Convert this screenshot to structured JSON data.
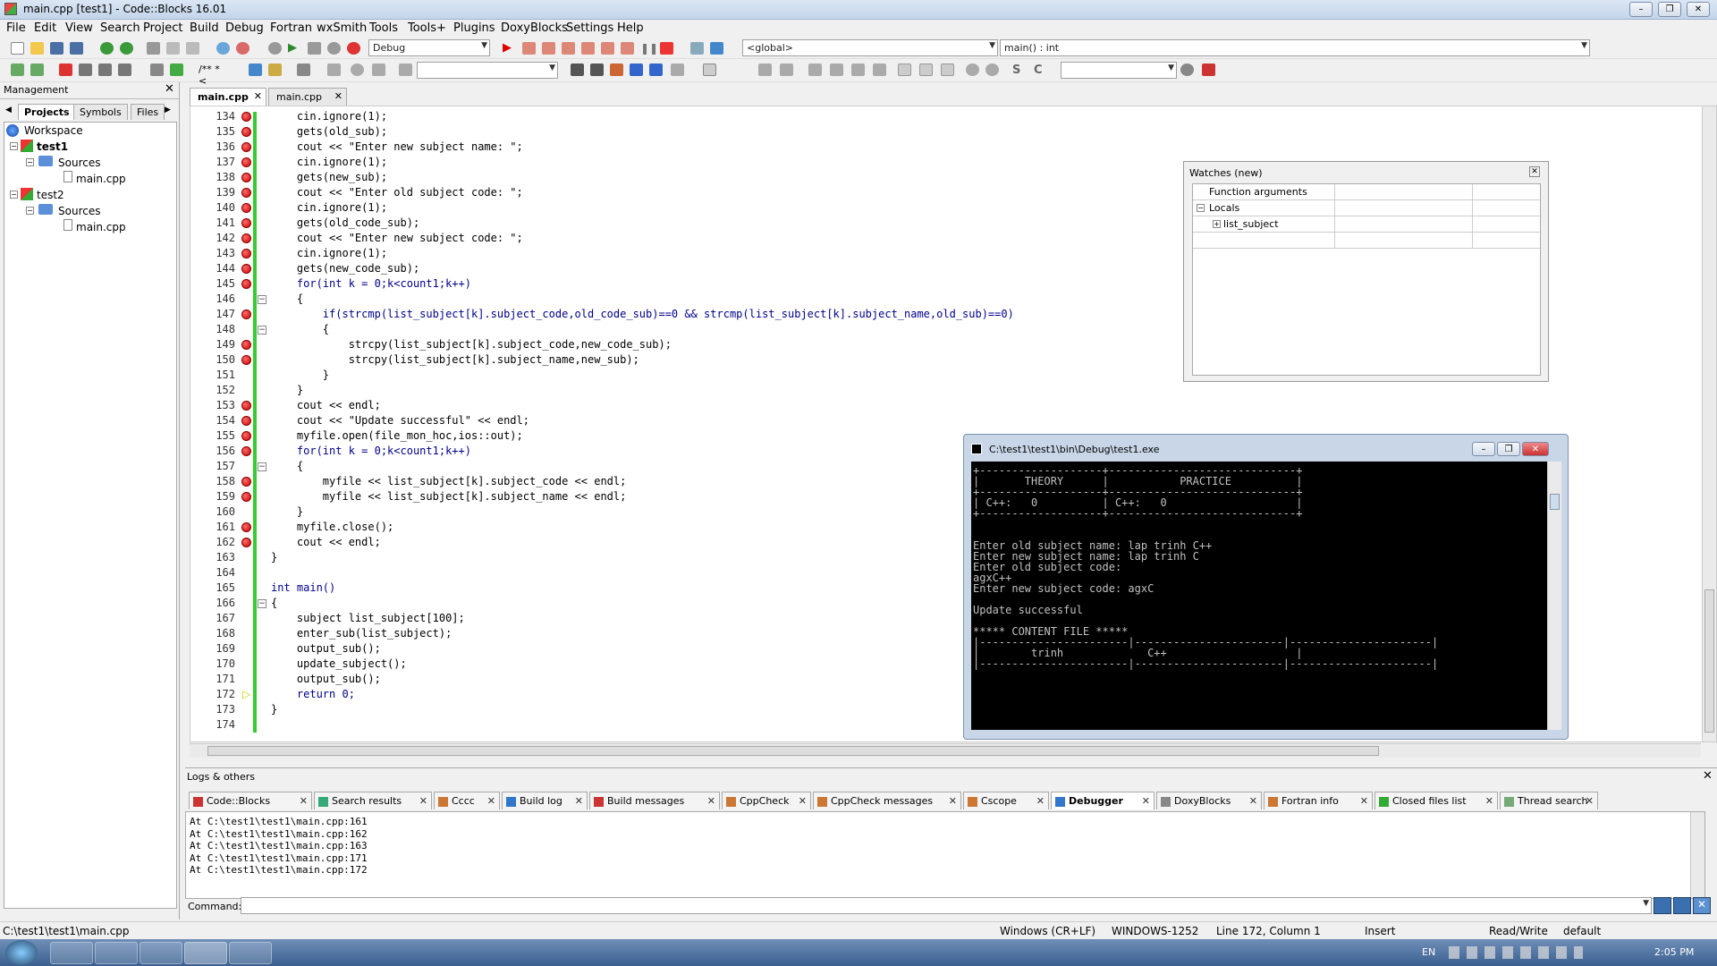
{
  "window": {
    "title": "main.cpp [test1] - Code::Blocks 16.01"
  },
  "menu": [
    "File",
    "Edit",
    "View",
    "Search",
    "Project",
    "Build",
    "Debug",
    "Fortran",
    "wxSmith",
    "Tools",
    "Tools+",
    "Plugins",
    "DoxyBlocks",
    "Settings",
    "Help"
  ],
  "toolbar": {
    "build_target": "Debug",
    "scope": "<global>",
    "function": "main() : int"
  },
  "management": {
    "title": "Management",
    "tabs": [
      "Projects",
      "Symbols",
      "Files"
    ],
    "tree": [
      "Workspace",
      "test1",
      "Sources",
      "main.cpp",
      "test2",
      "Sources",
      "main.cpp"
    ]
  },
  "editor": {
    "tabs": [
      "main.cpp",
      "main.cpp"
    ],
    "lines": [
      {
        "n": "134",
        "t": "    cin.ignore(1);"
      },
      {
        "n": "135",
        "t": "    gets(old_sub);"
      },
      {
        "n": "136",
        "t": "    cout << \"Enter new subject name: \";"
      },
      {
        "n": "137",
        "t": "    cin.ignore(1);"
      },
      {
        "n": "138",
        "t": "    gets(new_sub);"
      },
      {
        "n": "139",
        "t": "    cout << \"Enter old subject code: \";"
      },
      {
        "n": "140",
        "t": "    cin.ignore(1);"
      },
      {
        "n": "141",
        "t": "    gets(old_code_sub);"
      },
      {
        "n": "142",
        "t": "    cout << \"Enter new subject code: \";"
      },
      {
        "n": "143",
        "t": "    cin.ignore(1);"
      },
      {
        "n": "144",
        "t": "    gets(new_code_sub);"
      },
      {
        "n": "145",
        "t": "    for(int k = 0;k<count1;k++)"
      },
      {
        "n": "146",
        "t": "    {"
      },
      {
        "n": "147",
        "t": "        if(strcmp(list_subject[k].subject_code,old_code_sub)==0 && strcmp(list_subject[k].subject_name,old_sub)==0)"
      },
      {
        "n": "148",
        "t": "        {"
      },
      {
        "n": "149",
        "t": "            strcpy(list_subject[k].subject_code,new_code_sub);"
      },
      {
        "n": "150",
        "t": "            strcpy(list_subject[k].subject_name,new_sub);"
      },
      {
        "n": "151",
        "t": "        }"
      },
      {
        "n": "152",
        "t": "    }"
      },
      {
        "n": "153",
        "t": "    cout << endl;"
      },
      {
        "n": "154",
        "t": "    cout << \"Update successful\" << endl;"
      },
      {
        "n": "155",
        "t": "    myfile.open(file_mon_hoc,ios::out);"
      },
      {
        "n": "156",
        "t": "    for(int k = 0;k<count1;k++)"
      },
      {
        "n": "157",
        "t": "    {"
      },
      {
        "n": "158",
        "t": "        myfile << list_subject[k].subject_code << endl;"
      },
      {
        "n": "159",
        "t": "        myfile << list_subject[k].subject_name << endl;"
      },
      {
        "n": "160",
        "t": "    }"
      },
      {
        "n": "161",
        "t": "    myfile.close();"
      },
      {
        "n": "162",
        "t": "    cout << endl;"
      },
      {
        "n": "163",
        "t": "}"
      },
      {
        "n": "164",
        "t": ""
      },
      {
        "n": "165",
        "t": "int main()"
      },
      {
        "n": "166",
        "t": "{"
      },
      {
        "n": "167",
        "t": "    subject list_subject[100];"
      },
      {
        "n": "168",
        "t": "    enter_sub(list_subject);"
      },
      {
        "n": "169",
        "t": "    output_sub();"
      },
      {
        "n": "170",
        "t": "    update_subject();"
      },
      {
        "n": "171",
        "t": "    output_sub();"
      },
      {
        "n": "172",
        "t": "    return 0;"
      },
      {
        "n": "173",
        "t": "}"
      },
      {
        "n": "174",
        "t": ""
      }
    ]
  },
  "watches": {
    "title": "Watches (new)",
    "rows": [
      "Function arguments",
      "Locals",
      "list_subject"
    ]
  },
  "console": {
    "title": "C:\\test1\\test1\\bin\\Debug\\test1.exe",
    "lines": [
      "+-------------------+-----------------------------+",
      "|       THEORY      |           PRACTICE          |",
      "+-------------------+-----------------------------+",
      "| C++:   0          | C++:   0                    |",
      "+-------------------+-----------------------------+",
      "",
      "",
      "Enter old subject name: lap trinh C++",
      "Enter new subject name: lap trinh C",
      "Enter old subject code:",
      "agxC++",
      "Enter new subject code: agxC",
      "",
      "Update successful",
      "",
      "***** CONTENT FILE *****",
      "|-----------------------|-----------------------|----------------------|",
      "|        trinh             C++                    |",
      "|-----------------------|-----------------------|----------------------|"
    ]
  },
  "logs": {
    "title": "Logs & others",
    "tabs": [
      "Code::Blocks",
      "Search results",
      "Cccc",
      "Build log",
      "Build messages",
      "CppCheck",
      "CppCheck messages",
      "Cscope",
      "Debugger",
      "DoxyBlocks",
      "Fortran info",
      "Closed files list",
      "Thread search"
    ],
    "lines": [
      "At C:\\test1\\test1\\main.cpp:161",
      "At C:\\test1\\test1\\main.cpp:162",
      "At C:\\test1\\test1\\main.cpp:163",
      "At C:\\test1\\test1\\main.cpp:171",
      "At C:\\test1\\test1\\main.cpp:172"
    ],
    "command_label": "Command:"
  },
  "status": {
    "path": "C:\\test1\\test1\\main.cpp",
    "eol": "Windows (CR+LF)",
    "encoding": "WINDOWS-1252",
    "position": "Line 172, Column 1",
    "mode": "Insert",
    "access": "Read/Write",
    "lang": "default"
  },
  "taskbar": {
    "lang": "EN",
    "time": "2:05 PM"
  }
}
